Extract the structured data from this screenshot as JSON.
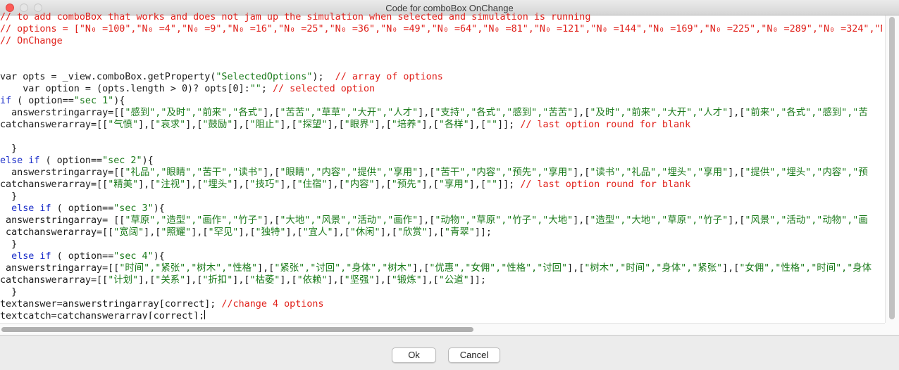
{
  "window": {
    "title": "Code for comboBox OnChange"
  },
  "editor": {
    "lines": [
      [
        {
          "c": "cm",
          "t": "// to add comboBox that works and does not jam up the simulation when selected and simulation is running"
        }
      ],
      [
        {
          "c": "cm",
          "t": "// options = [\"N₀ =100\",\"N₀ =4\",\"N₀ =9\",\"N₀ =16\",\"N₀ =25\",\"N₀ =36\",\"N₀ =49\",\"N₀ =64\",\"N₀ =81\",\"N₀ =121\",\"N₀ =144\",\"N₀ =169\",\"N₀ =225\",\"N₀ =289\",\"N₀ =324\",\"N₀"
        }
      ],
      [
        {
          "c": "cm",
          "t": "// OnChange"
        }
      ],
      [],
      [],
      [
        {
          "c": "",
          "t": "var opts = _view.comboBox.getProperty("
        },
        {
          "c": "st",
          "t": "\"SelectedOptions\""
        },
        {
          "c": "",
          "t": ");  "
        },
        {
          "c": "cm",
          "t": "// array of options"
        }
      ],
      [
        {
          "c": "",
          "t": "    var option = (opts.length > 0)? opts[0]:"
        },
        {
          "c": "st",
          "t": "\"\""
        },
        {
          "c": "",
          "t": "; "
        },
        {
          "c": "cm",
          "t": "// selected option"
        }
      ],
      [
        {
          "c": "kw",
          "t": "if"
        },
        {
          "c": "",
          "t": " ( option=="
        },
        {
          "c": "st",
          "t": "\"sec 1\""
        },
        {
          "c": "",
          "t": "){"
        }
      ],
      [
        {
          "c": "",
          "t": "  answerstringarray=[["
        },
        {
          "c": "st",
          "t": "\"感到\",\"及时\",\"前来\",\"各式\""
        },
        {
          "c": "",
          "t": "],["
        },
        {
          "c": "st",
          "t": "\"苦苦\",\"草草\",\"大开\",\"人才\""
        },
        {
          "c": "",
          "t": "],["
        },
        {
          "c": "st",
          "t": "\"支持\",\"各式\",\"感到\",\"苦苦\""
        },
        {
          "c": "",
          "t": "],["
        },
        {
          "c": "st",
          "t": "\"及时\",\"前来\",\"大开\",\"人才\""
        },
        {
          "c": "",
          "t": "],["
        },
        {
          "c": "st",
          "t": "\"前来\",\"各式\",\"感到\",\"苦"
        }
      ],
      [
        {
          "c": "",
          "t": "catchanswerarray=[["
        },
        {
          "c": "st",
          "t": "\"气愤\""
        },
        {
          "c": "",
          "t": "],["
        },
        {
          "c": "st",
          "t": "\"哀求\""
        },
        {
          "c": "",
          "t": "],["
        },
        {
          "c": "st",
          "t": "\"鼓励\""
        },
        {
          "c": "",
          "t": "],["
        },
        {
          "c": "st",
          "t": "\"阻止\""
        },
        {
          "c": "",
          "t": "],["
        },
        {
          "c": "st",
          "t": "\"探望\""
        },
        {
          "c": "",
          "t": "],["
        },
        {
          "c": "st",
          "t": "\"眼界\""
        },
        {
          "c": "",
          "t": "],["
        },
        {
          "c": "st",
          "t": "\"培养\""
        },
        {
          "c": "",
          "t": "],["
        },
        {
          "c": "st",
          "t": "\"各样\""
        },
        {
          "c": "",
          "t": "],["
        },
        {
          "c": "st",
          "t": "\"\""
        },
        {
          "c": "",
          "t": "]]; "
        },
        {
          "c": "cm",
          "t": "// last option round for blank"
        }
      ],
      [],
      [
        {
          "c": "",
          "t": "  }"
        }
      ],
      [
        {
          "c": "kw",
          "t": "else if"
        },
        {
          "c": "",
          "t": " ( option=="
        },
        {
          "c": "st",
          "t": "\"sec 2\""
        },
        {
          "c": "",
          "t": "){"
        }
      ],
      [
        {
          "c": "",
          "t": "  answerstringarray=[["
        },
        {
          "c": "st",
          "t": "\"礼品\",\"眼睛\",\"苦干\",\"读书\""
        },
        {
          "c": "",
          "t": "],["
        },
        {
          "c": "st",
          "t": "\"眼睛\",\"内容\",\"提供\",\"享用\""
        },
        {
          "c": "",
          "t": "],["
        },
        {
          "c": "st",
          "t": "\"苦干\",\"内容\",\"预先\",\"享用\""
        },
        {
          "c": "",
          "t": "],["
        },
        {
          "c": "st",
          "t": "\"读书\",\"礼品\",\"埋头\",\"享用\""
        },
        {
          "c": "",
          "t": "],["
        },
        {
          "c": "st",
          "t": "\"提供\",\"埋头\",\"内容\",\"预"
        }
      ],
      [
        {
          "c": "",
          "t": "catchanswerarray=[["
        },
        {
          "c": "st",
          "t": "\"精美\""
        },
        {
          "c": "",
          "t": "],["
        },
        {
          "c": "st",
          "t": "\"注视\""
        },
        {
          "c": "",
          "t": "],["
        },
        {
          "c": "st",
          "t": "\"埋头\""
        },
        {
          "c": "",
          "t": "],["
        },
        {
          "c": "st",
          "t": "\"技巧\""
        },
        {
          "c": "",
          "t": "],["
        },
        {
          "c": "st",
          "t": "\"住宿\""
        },
        {
          "c": "",
          "t": "],["
        },
        {
          "c": "st",
          "t": "\"内容\""
        },
        {
          "c": "",
          "t": "],["
        },
        {
          "c": "st",
          "t": "\"预先\""
        },
        {
          "c": "",
          "t": "],["
        },
        {
          "c": "st",
          "t": "\"享用\""
        },
        {
          "c": "",
          "t": "],["
        },
        {
          "c": "st",
          "t": "\"\""
        },
        {
          "c": "",
          "t": "]]; "
        },
        {
          "c": "cm",
          "t": "// last option round for blank"
        }
      ],
      [
        {
          "c": "",
          "t": "  }"
        }
      ],
      [
        {
          "c": "",
          "t": "  "
        },
        {
          "c": "kw",
          "t": "else if"
        },
        {
          "c": "",
          "t": " ( option=="
        },
        {
          "c": "st",
          "t": "\"sec 3\""
        },
        {
          "c": "",
          "t": "){"
        }
      ],
      [
        {
          "c": "",
          "t": " answerstringarray= [["
        },
        {
          "c": "st",
          "t": "\"草原\",\"造型\",\"画作\",\"竹子\""
        },
        {
          "c": "",
          "t": "],["
        },
        {
          "c": "st",
          "t": "\"大地\",\"风景\",\"活动\",\"画作\""
        },
        {
          "c": "",
          "t": "],["
        },
        {
          "c": "st",
          "t": "\"动物\",\"草原\",\"竹子\",\"大地\""
        },
        {
          "c": "",
          "t": "],["
        },
        {
          "c": "st",
          "t": "\"造型\",\"大地\",\"草原\",\"竹子\""
        },
        {
          "c": "",
          "t": "],["
        },
        {
          "c": "st",
          "t": "\"风景\",\"活动\",\"动物\",\"画"
        }
      ],
      [
        {
          "c": "",
          "t": " catchanswerarray=[["
        },
        {
          "c": "st",
          "t": "\"宽阔\""
        },
        {
          "c": "",
          "t": "],["
        },
        {
          "c": "st",
          "t": "\"照耀\""
        },
        {
          "c": "",
          "t": "],["
        },
        {
          "c": "st",
          "t": "\"罕见\""
        },
        {
          "c": "",
          "t": "],["
        },
        {
          "c": "st",
          "t": "\"独特\""
        },
        {
          "c": "",
          "t": "],["
        },
        {
          "c": "st",
          "t": "\"宜人\""
        },
        {
          "c": "",
          "t": "],["
        },
        {
          "c": "st",
          "t": "\"休闲\""
        },
        {
          "c": "",
          "t": "],["
        },
        {
          "c": "st",
          "t": "\"欣赏\""
        },
        {
          "c": "",
          "t": "],["
        },
        {
          "c": "st",
          "t": "\"青翠\""
        },
        {
          "c": "",
          "t": "]];"
        }
      ],
      [
        {
          "c": "",
          "t": "  }"
        }
      ],
      [
        {
          "c": "",
          "t": "  "
        },
        {
          "c": "kw",
          "t": "else if"
        },
        {
          "c": "",
          "t": " ( option=="
        },
        {
          "c": "st",
          "t": "\"sec 4\""
        },
        {
          "c": "",
          "t": "){"
        }
      ],
      [
        {
          "c": "",
          "t": " answerstringarray=[["
        },
        {
          "c": "st",
          "t": "\"时间\",\"紧张\",\"树木\",\"性格\""
        },
        {
          "c": "",
          "t": "],["
        },
        {
          "c": "st",
          "t": "\"紧张\",\"讨回\",\"身体\",\"树木\""
        },
        {
          "c": "",
          "t": "],["
        },
        {
          "c": "st",
          "t": "\"优惠\",\"女佣\",\"性格\",\"讨回\""
        },
        {
          "c": "",
          "t": "],["
        },
        {
          "c": "st",
          "t": "\"树木\",\"时间\",\"身体\",\"紧张\""
        },
        {
          "c": "",
          "t": "],["
        },
        {
          "c": "st",
          "t": "\"女佣\",\"性格\",\"时间\",\"身体"
        }
      ],
      [
        {
          "c": "",
          "t": "catchanswerarray=[["
        },
        {
          "c": "st",
          "t": "\"计划\""
        },
        {
          "c": "",
          "t": "],["
        },
        {
          "c": "st",
          "t": "\"关系\""
        },
        {
          "c": "",
          "t": "],["
        },
        {
          "c": "st",
          "t": "\"折扣\""
        },
        {
          "c": "",
          "t": "],["
        },
        {
          "c": "st",
          "t": "\"枯萎\""
        },
        {
          "c": "",
          "t": "],["
        },
        {
          "c": "st",
          "t": "\"依赖\""
        },
        {
          "c": "",
          "t": "],["
        },
        {
          "c": "st",
          "t": "\"坚强\""
        },
        {
          "c": "",
          "t": "],["
        },
        {
          "c": "st",
          "t": "\"锻炼\""
        },
        {
          "c": "",
          "t": "],["
        },
        {
          "c": "st",
          "t": "\"公道\""
        },
        {
          "c": "",
          "t": "]];"
        }
      ],
      [
        {
          "c": "",
          "t": "  }"
        }
      ],
      [
        {
          "c": "",
          "t": "textanswer=answerstringarray[correct]; "
        },
        {
          "c": "cm",
          "t": "//change 4 options"
        }
      ],
      [
        {
          "c": "",
          "t": "textcatch=catchanswerarray[correct];"
        },
        {
          "c": "caret",
          "t": ""
        }
      ]
    ]
  },
  "buttons": {
    "ok_label": "Ok",
    "cancel_label": "Cancel"
  }
}
